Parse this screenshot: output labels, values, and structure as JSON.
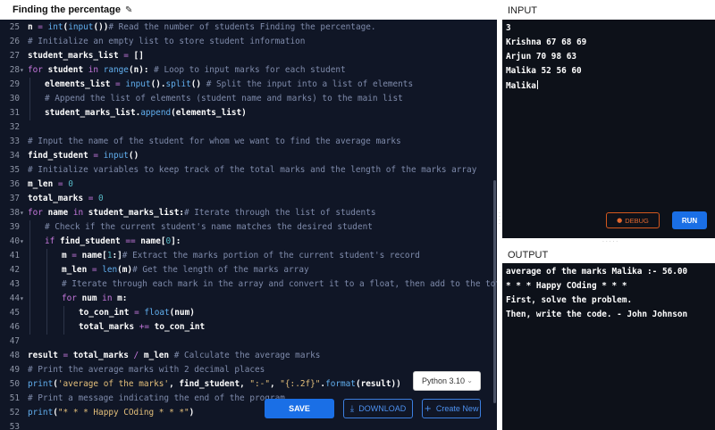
{
  "header": {
    "title": "Finding the percentage",
    "edit_icon": "pencil-icon"
  },
  "editor": {
    "lines": [
      {
        "n": "25",
        "fold": "",
        "indent": 0,
        "segs": [
          [
            "v",
            "n "
          ],
          [
            "op",
            "="
          ],
          [
            "v",
            " "
          ],
          [
            "fn",
            "int"
          ],
          [
            "v",
            "("
          ],
          [
            "fn",
            "input"
          ],
          [
            "v",
            "())"
          ],
          [
            "cm",
            "# Read the number of students Finding the percentage."
          ]
        ]
      },
      {
        "n": "26",
        "fold": "",
        "indent": 0,
        "segs": [
          [
            "cm",
            "# Initialize an empty list to store student information"
          ]
        ]
      },
      {
        "n": "27",
        "fold": "",
        "indent": 0,
        "segs": [
          [
            "v",
            "student_marks_list "
          ],
          [
            "op",
            "="
          ],
          [
            "v",
            " []"
          ]
        ]
      },
      {
        "n": "28",
        "fold": "▾",
        "indent": 0,
        "segs": [
          [
            "kw",
            "for"
          ],
          [
            "v",
            " student "
          ],
          [
            "kw",
            "in"
          ],
          [
            "v",
            " "
          ],
          [
            "fn",
            "range"
          ],
          [
            "v",
            "(n): "
          ],
          [
            "cm",
            "# Loop to input marks for each student"
          ]
        ]
      },
      {
        "n": "29",
        "fold": "",
        "indent": 1,
        "segs": [
          [
            "v",
            "elements_list "
          ],
          [
            "op",
            "="
          ],
          [
            "v",
            " "
          ],
          [
            "fn",
            "input"
          ],
          [
            "v",
            "()."
          ],
          [
            "fn",
            "split"
          ],
          [
            "v",
            "() "
          ],
          [
            "cm",
            "# Split the input into a list of elements"
          ]
        ]
      },
      {
        "n": "30",
        "fold": "",
        "indent": 1,
        "segs": [
          [
            "cm",
            "# Append the list of elements (student name and marks) to the main list"
          ]
        ]
      },
      {
        "n": "31",
        "fold": "",
        "indent": 1,
        "segs": [
          [
            "v",
            "student_marks_list."
          ],
          [
            "fn",
            "append"
          ],
          [
            "v",
            "(elements_list)"
          ]
        ]
      },
      {
        "n": "32",
        "fold": "",
        "indent": 0,
        "segs": []
      },
      {
        "n": "33",
        "fold": "",
        "indent": 0,
        "segs": [
          [
            "cm",
            "# Input the name of the student for whom we want to find the average marks"
          ]
        ]
      },
      {
        "n": "34",
        "fold": "",
        "indent": 0,
        "segs": [
          [
            "v",
            "find_student "
          ],
          [
            "op",
            "="
          ],
          [
            "v",
            " "
          ],
          [
            "fn",
            "input"
          ],
          [
            "v",
            "()"
          ]
        ]
      },
      {
        "n": "35",
        "fold": "",
        "indent": 0,
        "segs": [
          [
            "cm",
            "# Initialize variables to keep track of the total marks and the length of the marks array"
          ]
        ]
      },
      {
        "n": "36",
        "fold": "",
        "indent": 0,
        "segs": [
          [
            "v",
            "m_len "
          ],
          [
            "op",
            "="
          ],
          [
            "v",
            " "
          ],
          [
            "nm",
            "0"
          ]
        ]
      },
      {
        "n": "37",
        "fold": "",
        "indent": 0,
        "segs": [
          [
            "v",
            "total_marks "
          ],
          [
            "op",
            "="
          ],
          [
            "v",
            " "
          ],
          [
            "nm",
            "0"
          ]
        ]
      },
      {
        "n": "38",
        "fold": "▾",
        "indent": 0,
        "segs": [
          [
            "kw",
            "for"
          ],
          [
            "v",
            " name "
          ],
          [
            "kw",
            "in"
          ],
          [
            "v",
            " student_marks_list:"
          ],
          [
            "cm",
            "# Iterate through the list of students"
          ]
        ]
      },
      {
        "n": "39",
        "fold": "",
        "indent": 1,
        "segs": [
          [
            "cm",
            "# Check if the current student's name matches the desired student"
          ]
        ]
      },
      {
        "n": "40",
        "fold": "▾",
        "indent": 1,
        "segs": [
          [
            "kw",
            "if"
          ],
          [
            "v",
            " find_student "
          ],
          [
            "op",
            "=="
          ],
          [
            "v",
            " name["
          ],
          [
            "nm",
            "0"
          ],
          [
            "v",
            "]:"
          ]
        ]
      },
      {
        "n": "41",
        "fold": "",
        "indent": 2,
        "segs": [
          [
            "v",
            "m "
          ],
          [
            "op",
            "="
          ],
          [
            "v",
            " name["
          ],
          [
            "nm",
            "1"
          ],
          [
            "v",
            ":]"
          ],
          [
            "cm",
            "# Extract the marks portion of the current student's record"
          ]
        ]
      },
      {
        "n": "42",
        "fold": "",
        "indent": 2,
        "segs": [
          [
            "v",
            "m_len "
          ],
          [
            "op",
            "="
          ],
          [
            "v",
            " "
          ],
          [
            "fn",
            "len"
          ],
          [
            "v",
            "(m)"
          ],
          [
            "cm",
            "# Get the length of the marks array"
          ]
        ]
      },
      {
        "n": "43",
        "fold": "",
        "indent": 2,
        "segs": [
          [
            "cm",
            "# Iterate through each mark in the array and convert it to a float, then add to the total"
          ]
        ]
      },
      {
        "n": "44",
        "fold": "▾",
        "indent": 2,
        "segs": [
          [
            "kw",
            "for"
          ],
          [
            "v",
            " num "
          ],
          [
            "kw",
            "in"
          ],
          [
            "v",
            " m:"
          ]
        ]
      },
      {
        "n": "45",
        "fold": "",
        "indent": 3,
        "segs": [
          [
            "v",
            "to_con_int "
          ],
          [
            "op",
            "="
          ],
          [
            "v",
            " "
          ],
          [
            "fn",
            "float"
          ],
          [
            "v",
            "(num)"
          ]
        ]
      },
      {
        "n": "46",
        "fold": "",
        "indent": 3,
        "segs": [
          [
            "v",
            "total_marks "
          ],
          [
            "op",
            "+="
          ],
          [
            "v",
            " to_con_int"
          ]
        ]
      },
      {
        "n": "47",
        "fold": "",
        "indent": 0,
        "segs": []
      },
      {
        "n": "48",
        "fold": "",
        "indent": 0,
        "segs": [
          [
            "v",
            "result "
          ],
          [
            "op",
            "="
          ],
          [
            "v",
            " total_marks "
          ],
          [
            "op",
            "/"
          ],
          [
            "v",
            " m_len "
          ],
          [
            "cm",
            "# Calculate the average marks"
          ]
        ]
      },
      {
        "n": "49",
        "fold": "",
        "indent": 0,
        "segs": [
          [
            "cm",
            "# Print the average marks with 2 decimal places"
          ]
        ]
      },
      {
        "n": "50",
        "fold": "",
        "indent": 0,
        "segs": [
          [
            "fn",
            "print"
          ],
          [
            "v",
            "("
          ],
          [
            "st",
            "'average of the marks'"
          ],
          [
            "v",
            ", find_student, "
          ],
          [
            "st",
            "\":-\""
          ],
          [
            "v",
            ", "
          ],
          [
            "st",
            "\"{:.2f}\""
          ],
          [
            "v",
            "."
          ],
          [
            "fn",
            "format"
          ],
          [
            "v",
            "(result))"
          ]
        ]
      },
      {
        "n": "51",
        "fold": "",
        "indent": 0,
        "segs": [
          [
            "cm",
            "# Print a message indicating the end of the program"
          ]
        ]
      },
      {
        "n": "52",
        "fold": "",
        "indent": 0,
        "segs": [
          [
            "fn",
            "print"
          ],
          [
            "v",
            "("
          ],
          [
            "st",
            "\"* * * Happy COding * * *\""
          ],
          [
            "v",
            ")"
          ]
        ]
      },
      {
        "n": "53",
        "fold": "",
        "indent": 0,
        "segs": []
      }
    ]
  },
  "toolbar": {
    "python_version": "Python 3.10",
    "save_label": "SAVE",
    "download_label": "DOWNLOAD",
    "new_label": "Create New"
  },
  "input_panel": {
    "title": "INPUT",
    "lines": [
      "3",
      "Krishna 67 68 69",
      "Arjun 70 98 63",
      "Malika 52 56 60",
      "Malika"
    ],
    "debug_label": "DEBUG",
    "run_label": "RUN"
  },
  "output_panel": {
    "title": "OUTPUT",
    "lines": [
      "average of the marks Malika :- 56.00",
      "* * * Happy COding * * *",
      "First, solve the problem.",
      "Then, write the code. - John Johnson"
    ]
  },
  "colors": {
    "accent": "#1a6fe6",
    "debug": "#d4581e",
    "editor_bg": "#101626"
  }
}
